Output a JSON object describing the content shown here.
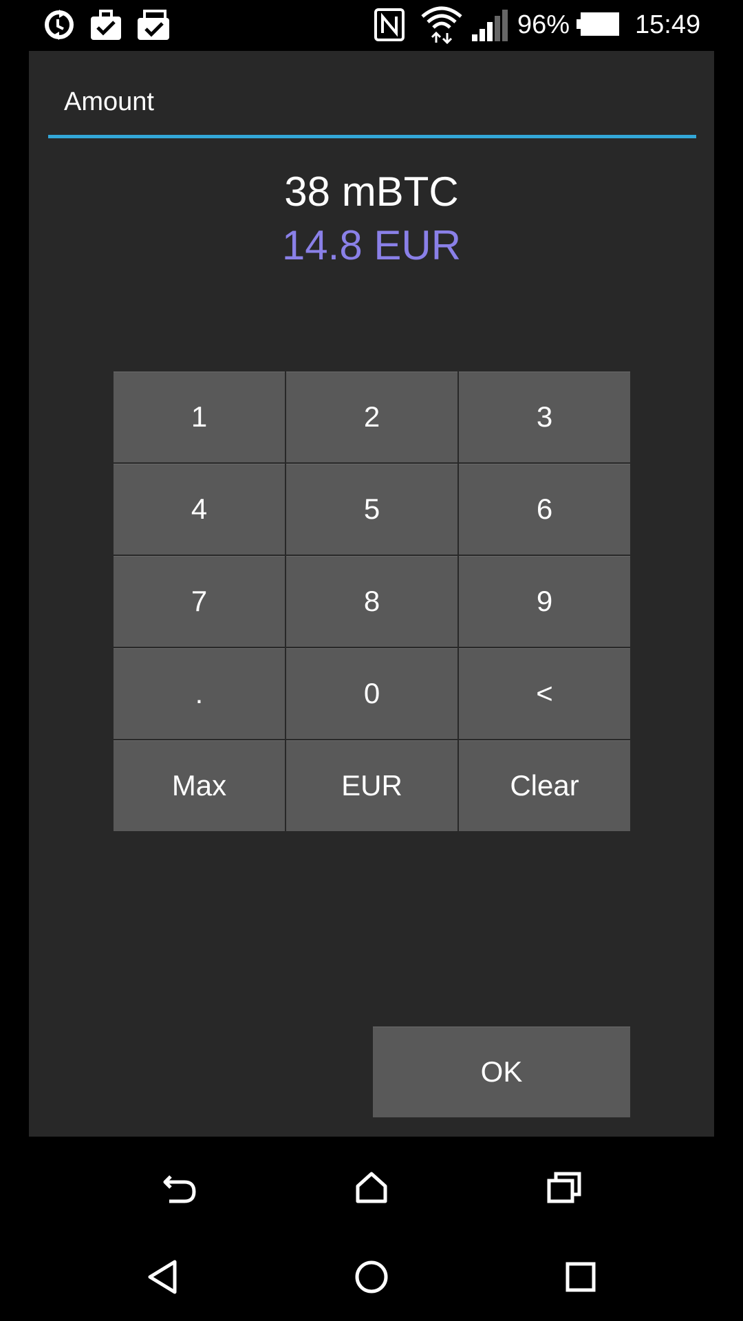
{
  "status_bar": {
    "battery_percent": "96%",
    "time": "15:49",
    "icons": [
      "sync-icon",
      "briefcase-check-icon",
      "clipboard-check-icon",
      "nfc-icon",
      "wifi-icon",
      "signal-icon",
      "battery-icon"
    ]
  },
  "dialog": {
    "title": "Amount",
    "amount_primary": "38 mBTC",
    "amount_secondary": "14.8 EUR",
    "accent_color": "#33a7d8",
    "secondary_color": "#8a80e8"
  },
  "keypad": {
    "keys": [
      "1",
      "2",
      "3",
      "4",
      "5",
      "6",
      "7",
      "8",
      "9",
      ".",
      "0",
      "<",
      "Max",
      "EUR",
      "Clear"
    ]
  },
  "actions": {
    "ok_label": "OK"
  },
  "nav": {
    "top_row": [
      "back-icon",
      "home-icon",
      "recents-icon"
    ],
    "bottom_row": [
      "back-triangle-icon",
      "home-circle-icon",
      "recents-square-icon"
    ]
  }
}
